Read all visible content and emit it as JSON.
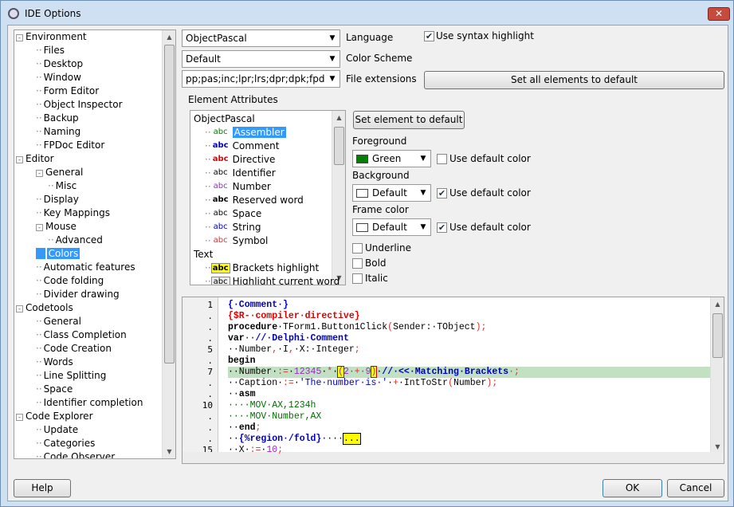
{
  "window": {
    "title": "IDE Options",
    "close": "✕"
  },
  "tree": [
    {
      "label": "Environment",
      "level": 0,
      "exp": "-"
    },
    {
      "label": "Files",
      "level": 1
    },
    {
      "label": "Desktop",
      "level": 1
    },
    {
      "label": "Window",
      "level": 1
    },
    {
      "label": "Form Editor",
      "level": 1
    },
    {
      "label": "Object Inspector",
      "level": 1
    },
    {
      "label": "Backup",
      "level": 1
    },
    {
      "label": "Naming",
      "level": 1
    },
    {
      "label": "FPDoc Editor",
      "level": 1
    },
    {
      "label": "Editor",
      "level": 0,
      "exp": "-"
    },
    {
      "label": "General",
      "level": 1,
      "exp": "-"
    },
    {
      "label": "Misc",
      "level": 2
    },
    {
      "label": "Display",
      "level": 1
    },
    {
      "label": "Key Mappings",
      "level": 1
    },
    {
      "label": "Mouse",
      "level": 1,
      "exp": "-"
    },
    {
      "label": "Advanced",
      "level": 2
    },
    {
      "label": "Colors",
      "level": 1,
      "selected": true
    },
    {
      "label": "Automatic features",
      "level": 1
    },
    {
      "label": "Code folding",
      "level": 1
    },
    {
      "label": "Divider drawing",
      "level": 1
    },
    {
      "label": "Codetools",
      "level": 0,
      "exp": "-"
    },
    {
      "label": "General",
      "level": 1
    },
    {
      "label": "Class Completion",
      "level": 1
    },
    {
      "label": "Code Creation",
      "level": 1
    },
    {
      "label": "Words",
      "level": 1
    },
    {
      "label": "Line Splitting",
      "level": 1
    },
    {
      "label": "Space",
      "level": 1
    },
    {
      "label": "Identifier completion",
      "level": 1
    },
    {
      "label": "Code Explorer",
      "level": 0,
      "exp": "-"
    },
    {
      "label": "Update",
      "level": 1
    },
    {
      "label": "Categories",
      "level": 1
    },
    {
      "label": "Code Observer",
      "level": 1
    }
  ],
  "top": {
    "language": "ObjectPascal",
    "language_label": "Language",
    "scheme": "Default",
    "scheme_label": "Color Scheme",
    "ext": "pp;pas;inc;lpr;lrs;dpr;dpk;fpd",
    "ext_label": "File extensions",
    "syntax_label": "Use syntax highlight",
    "syntax_checked": true,
    "set_all": "Set all elements to default"
  },
  "attrs": {
    "group_label": "Element Attributes",
    "set_element": "Set element to default",
    "groups": [
      {
        "label": "ObjectPascal",
        "items": [
          {
            "label": "Assembler",
            "abc_color": "#008000",
            "selected": true
          },
          {
            "label": "Comment",
            "abc_color": "#0000c0",
            "bold": true
          },
          {
            "label": "Directive",
            "abc_color": "#e00000",
            "bold": true
          },
          {
            "label": "Identifier",
            "abc_color": "#000000"
          },
          {
            "label": "Number",
            "abc_color": "#9030c0"
          },
          {
            "label": "Reserved word",
            "abc_color": "#000000",
            "bold": true
          },
          {
            "label": "Space",
            "abc_color": "#000000"
          },
          {
            "label": "String",
            "abc_color": "#0000c0"
          },
          {
            "label": "Symbol",
            "abc_color": "#e03030"
          }
        ]
      },
      {
        "label": "Text",
        "items": [
          {
            "label": "Brackets highlight",
            "abc_color": "#000000",
            "bg": "#ffff00",
            "bold": true
          },
          {
            "label": "Highlight current word",
            "abc_color": "#000000",
            "bg": "#eeeeee"
          }
        ]
      }
    ],
    "foreground_label": "Foreground",
    "foreground": "Green",
    "foreground_color": "#008000",
    "fg_default": "Use default color",
    "fg_default_checked": false,
    "background_label": "Background",
    "background": "Default",
    "background_color": "#ffffff",
    "bg_default": "Use default color",
    "bg_default_checked": true,
    "frame_label": "Frame color",
    "frame": "Default",
    "frame_color": "#ffffff",
    "fr_default": "Use default color",
    "fr_default_checked": true,
    "underline": "Underline",
    "bold": "Bold",
    "italic": "Italic"
  },
  "code": {
    "gutter": [
      "1",
      ".",
      ".",
      ".",
      "5",
      ".",
      "7",
      ".",
      ".",
      "10",
      ".",
      ".",
      ".",
      "15"
    ],
    "lines": [
      [
        [
          "{·Comment·}",
          "cm"
        ]
      ],
      [
        [
          "{$R-·compiler·directive}",
          "dir"
        ]
      ],
      [
        [
          "procedure",
          "kw"
        ],
        [
          "·TForm1.Button1Click",
          "id"
        ],
        [
          "(",
          "sym"
        ],
        [
          "Sender:·TObject",
          "id"
        ],
        [
          ");",
          "sym"
        ]
      ],
      [
        [
          "var",
          "kw"
        ],
        [
          "··",
          "id"
        ],
        [
          "//·Delphi·Comment",
          "cm"
        ]
      ],
      [
        [
          "··Number",
          "id"
        ],
        [
          ",",
          "sym"
        ],
        [
          "·I",
          "id"
        ],
        [
          ",",
          "sym"
        ],
        [
          "·X:·Integer",
          "id"
        ],
        [
          ";",
          "sym"
        ]
      ],
      [
        [
          "begin",
          "kw"
        ]
      ],
      [
        [
          "··Number·",
          "id"
        ],
        [
          ":=",
          "sym"
        ],
        [
          "·",
          "id"
        ],
        [
          "12345",
          "num"
        ],
        [
          "·",
          "id"
        ],
        [
          "*",
          "sym"
        ],
        [
          "·",
          "id"
        ],
        [
          "(",
          "br"
        ],
        [
          "2·",
          "num"
        ],
        [
          "+",
          "sym"
        ],
        [
          "·9",
          "num"
        ],
        [
          ")",
          "br"
        ],
        [
          "·",
          "id"
        ],
        [
          "//·<<·Matching·Brackets",
          "cm"
        ],
        [
          "·;",
          "sym"
        ]
      ],
      [
        [
          "··Caption·",
          "id"
        ],
        [
          ":=",
          "sym"
        ],
        [
          "·",
          "id"
        ],
        [
          "'The·number·is·'",
          "str"
        ],
        [
          "·",
          "id"
        ],
        [
          "+",
          "sym"
        ],
        [
          "·IntToStr",
          "id"
        ],
        [
          "(",
          "sym"
        ],
        [
          "Number",
          "id"
        ],
        [
          ");",
          "sym"
        ]
      ],
      [
        [
          "··",
          "id"
        ],
        [
          "asm",
          "kw"
        ]
      ],
      [
        [
          "····MOV·AX,1234h",
          "asm"
        ]
      ],
      [
        [
          "····MOV·Number,AX",
          "asm"
        ]
      ],
      [
        [
          "··",
          "id"
        ],
        [
          "end",
          "kw"
        ],
        [
          ";",
          "sym"
        ]
      ],
      [
        [
          "··",
          "id"
        ],
        [
          "{%region·/fold}",
          "cm"
        ],
        [
          "····",
          "id"
        ],
        [
          "...",
          "fold"
        ]
      ],
      [
        [
          "··X·",
          "id"
        ],
        [
          ":=",
          "sym"
        ],
        [
          "·",
          "id"
        ],
        [
          "10",
          "num"
        ],
        [
          ";",
          "sym"
        ]
      ]
    ]
  },
  "footer": {
    "help": "Help",
    "ok": "OK",
    "cancel": "Cancel"
  }
}
